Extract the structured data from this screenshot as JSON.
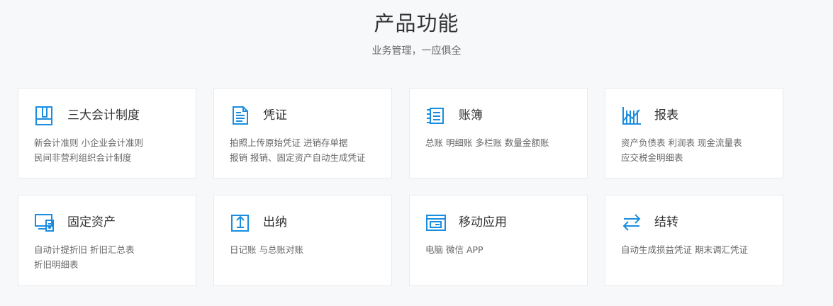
{
  "header": {
    "title": "产品功能",
    "subtitle": "业务管理，一应俱全"
  },
  "colors": {
    "accent": "#1a8de0",
    "background": "#f7f8fa",
    "card_border": "#e8eaee",
    "title_text": "#333333",
    "body_text": "#666666"
  },
  "cards": [
    {
      "icon": "accounting-standards-icon",
      "title": "三大会计制度",
      "lines": [
        "新会计准则 小企业会计准则",
        "民间非营利组织会计制度"
      ]
    },
    {
      "icon": "voucher-icon",
      "title": "凭证",
      "lines": [
        "拍照上传原始凭证 进销存单据",
        "报销 报销、固定资产自动生成凭证"
      ]
    },
    {
      "icon": "ledger-icon",
      "title": "账簿",
      "lines": [
        "总账 明细账 多栏账 数量金额账"
      ]
    },
    {
      "icon": "report-chart-icon",
      "title": "报表",
      "lines": [
        "资产负债表 利润表 现金流量表",
        "应交税金明细表"
      ]
    },
    {
      "icon": "fixed-assets-icon",
      "title": "固定资产",
      "lines": [
        "自动计提折旧 折旧汇总表",
        "折旧明细表"
      ]
    },
    {
      "icon": "cashier-icon",
      "title": "出纳",
      "lines": [
        "日记账 与总账对账"
      ]
    },
    {
      "icon": "mobile-app-icon",
      "title": "移动应用",
      "lines": [
        "电脑 微信 APP"
      ]
    },
    {
      "icon": "carry-forward-icon",
      "title": "结转",
      "lines": [
        "自动生成损益凭证 期末调汇凭证"
      ]
    }
  ]
}
